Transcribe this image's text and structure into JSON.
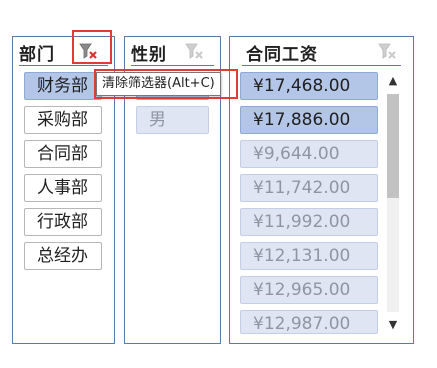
{
  "slicers": {
    "dept": {
      "title": "部门",
      "items": [
        "财务部",
        "采购部",
        "合同部",
        "人事部",
        "行政部",
        "总经办"
      ]
    },
    "gender": {
      "title": "性别",
      "items": [
        "男"
      ]
    },
    "salary": {
      "title": "合同工资",
      "items": [
        "¥17,468.00",
        "¥17,886.00",
        "¥9,644.00",
        "¥11,742.00",
        "¥11,992.00",
        "¥12,131.00",
        "¥12,965.00",
        "¥12,987.00"
      ]
    }
  },
  "tooltip": {
    "text": "清除筛选器(Alt+C)"
  },
  "scrollbar": {
    "up_arrow": "▲",
    "down_arrow": "▼"
  },
  "colors": {
    "selected": "#b4c6e7",
    "unavailable": "#dfe5f3",
    "border": "#5b7aa7",
    "highlight": "#e03c31"
  },
  "icons": {
    "clear_filter": "clear-filter-icon"
  }
}
